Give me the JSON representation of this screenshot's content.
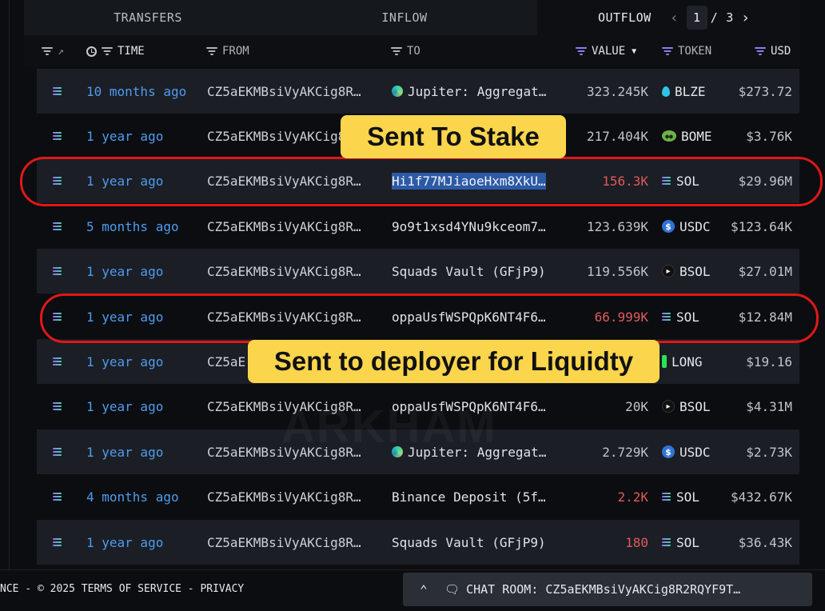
{
  "tabs": [
    {
      "label": "TRANSFERS"
    },
    {
      "label": "INFLOW"
    },
    {
      "label": "OUTFLOW"
    }
  ],
  "pagination": {
    "current": "1",
    "separator": "/",
    "total": "3",
    "prev_icon": "chevron-left-icon",
    "next_icon": "chevron-right-icon"
  },
  "columns": {
    "time": "TIME",
    "from": "FROM",
    "to": "TO",
    "value": "VALUE",
    "token": "TOKEN",
    "usd": "USD"
  },
  "rows": [
    {
      "time": "10 months ago",
      "from": "CZ5aEKMBsiVyAKCig8R…",
      "to": "Jupiter: Aggregat…",
      "to_icon": "jupiter",
      "value": "323.245K",
      "value_red": false,
      "token": "BLZE",
      "token_icon": "blze",
      "usd": "$273.72"
    },
    {
      "time": "1 year ago",
      "from": "CZ5aEKMBsiVyAKCig8R…",
      "to": "",
      "to_icon": "",
      "value": "217.404K",
      "value_red": false,
      "token": "BOME",
      "token_icon": "bome",
      "usd": "$3.76K"
    },
    {
      "time": "1 year ago",
      "from": "CZ5aEKMBsiVyAKCig8R…",
      "to": "Hi1f77MJiaoeHxm8XkU…",
      "to_icon": "",
      "to_selected": true,
      "value": "156.3K",
      "value_red": true,
      "token": "SOL",
      "token_icon": "sol",
      "usd": "$29.96M"
    },
    {
      "time": "5 months ago",
      "from": "CZ5aEKMBsiVyAKCig8R…",
      "to": "9o9t1xsd4YNu9kceom7…",
      "to_icon": "",
      "value": "123.639K",
      "value_red": false,
      "token": "USDC",
      "token_icon": "usdc",
      "usd": "$123.64K"
    },
    {
      "time": "1 year ago",
      "from": "CZ5aEKMBsiVyAKCig8R…",
      "to": "Squads Vault (GFjP9)",
      "to_icon": "",
      "value": "119.556K",
      "value_red": false,
      "token": "BSOL",
      "token_icon": "bsol",
      "usd": "$27.01M"
    },
    {
      "time": "1 year ago",
      "from": "CZ5aEKMBsiVyAKCig8R…",
      "to": "oppaUsfWSPQpK6NT4F6…",
      "to_icon": "",
      "value": "66.999K",
      "value_red": true,
      "token": "SOL",
      "token_icon": "sol",
      "usd": "$12.84M"
    },
    {
      "time": "1 year ago",
      "from": "CZ5aE",
      "to": "",
      "to_icon": "",
      "value": "",
      "value_red": false,
      "token": "LONG",
      "token_icon": "long",
      "usd": "$19.16"
    },
    {
      "time": "1 year ago",
      "from": "CZ5aEKMBsiVyAKCig8R…",
      "to": "oppaUsfWSPQpK6NT4F6…",
      "to_icon": "",
      "value": "20K",
      "value_red": false,
      "token": "BSOL",
      "token_icon": "bsol",
      "usd": "$4.31M"
    },
    {
      "time": "1 year ago",
      "from": "CZ5aEKMBsiVyAKCig8R…",
      "to": "Jupiter: Aggregat…",
      "to_icon": "jupiter",
      "value": "2.729K",
      "value_red": false,
      "token": "USDC",
      "token_icon": "usdc",
      "usd": "$2.73K"
    },
    {
      "time": "4 months ago",
      "from": "CZ5aEKMBsiVyAKCig8R…",
      "to": "Binance Deposit (5f…",
      "to_icon": "",
      "value": "2.2K",
      "value_red": true,
      "token": "SOL",
      "token_icon": "sol",
      "usd": "$432.67K"
    },
    {
      "time": "1 year ago",
      "from": "CZ5aEKMBsiVyAKCig8R…",
      "to": "Squads Vault (GFjP9)",
      "to_icon": "",
      "value": "180",
      "value_red": true,
      "token": "SOL",
      "token_icon": "sol",
      "usd": "$36.43K"
    }
  ],
  "annotations": {
    "stake_label": "Sent To Stake",
    "deployer_label": "Sent to deployer for Liquidty",
    "highlight_color": "#e01818",
    "callout_color": "#fbd54c"
  },
  "watermark": "ARKHAM",
  "footer": {
    "legal": "NCE - © 2025  TERMS OF SERVICE - PRIVACY",
    "chat_label": "CHAT ROOM: CZ5aEKMBsiVyAKCig8R2RQYF9T…"
  },
  "colors": {
    "accent_blue": "#4f9cf0",
    "value_red": "#e05a5a",
    "filter_purple": "#8d7cf0"
  }
}
